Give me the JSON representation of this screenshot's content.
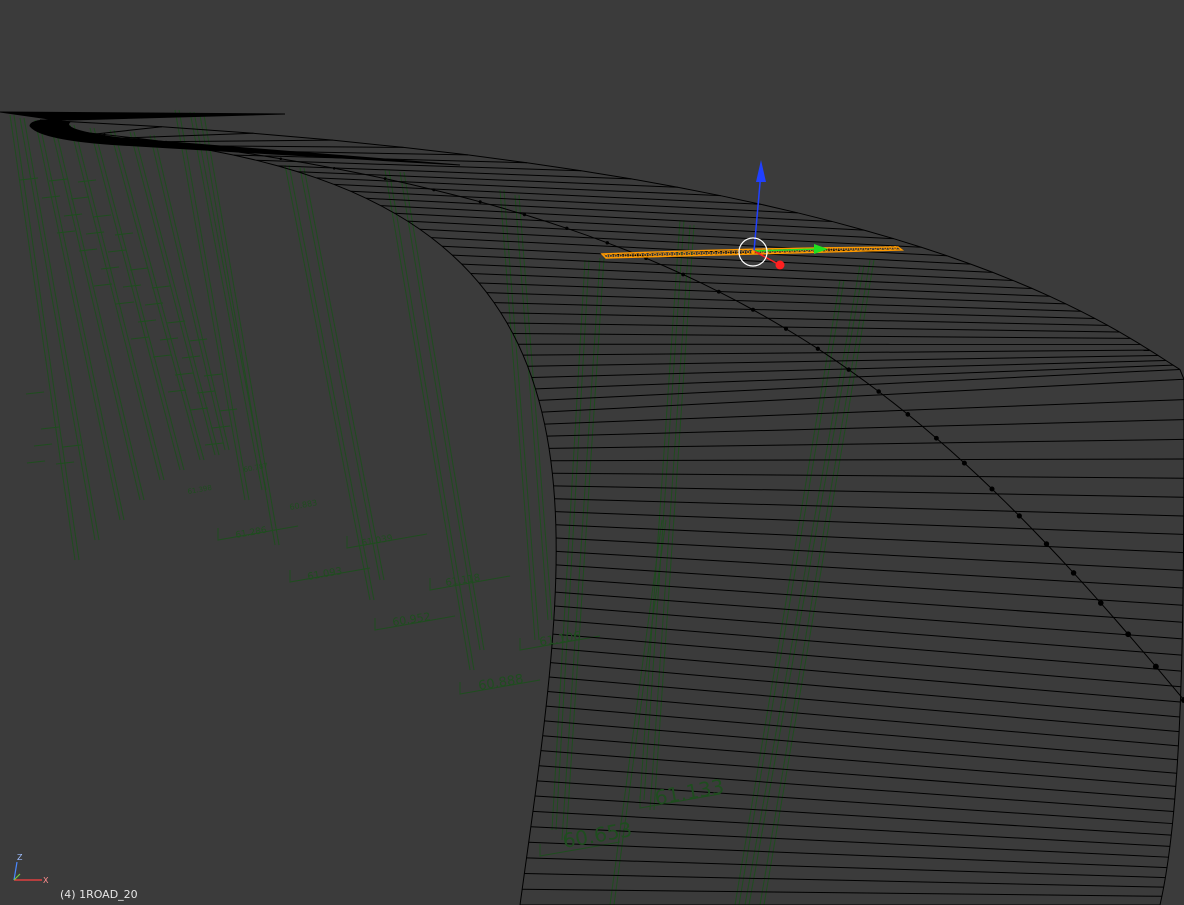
{
  "viewport": {
    "status_text": "(4) 1ROAD_20",
    "background_color": "#3b3b3b",
    "wire_color": "#000000",
    "annotation_color": "#1f4d1f",
    "selection_color": "#ff9a00"
  },
  "axis_indicator": {
    "z_label": "Z",
    "x_label": "X",
    "z_color": "#4a88ff",
    "x_color": "#ff4040",
    "y_color": "#70d040"
  },
  "gizmo": {
    "x_color": "#ff2020",
    "y_color": "#20e020",
    "z_color": "#2040ff",
    "pivot_ring_color": "#ffffff"
  },
  "elevation_labels": [
    "61.286",
    "61.093",
    "61.039",
    "60.952",
    "61.118",
    "60.888",
    "61.106",
    "60.653",
    "61.133",
    "60.883",
    "61.398",
    "60.787"
  ]
}
